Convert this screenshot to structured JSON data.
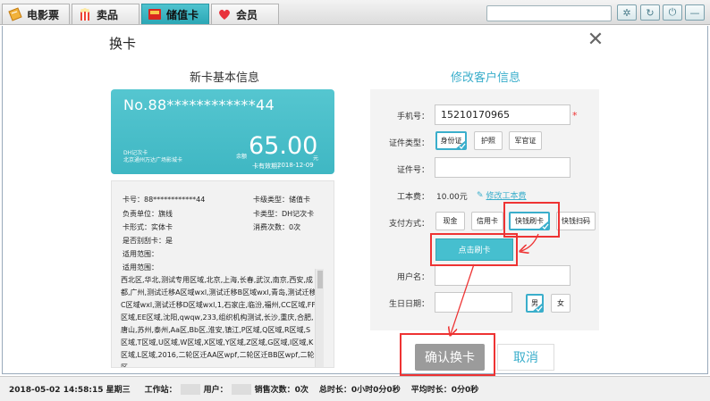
{
  "tabs": [
    {
      "label": "电影票",
      "icon": "ticket-icon",
      "active": false
    },
    {
      "label": "卖品",
      "icon": "popcorn-icon",
      "active": false
    },
    {
      "label": "储值卡",
      "icon": "card-icon",
      "active": true
    },
    {
      "label": "会员",
      "icon": "heart-icon",
      "active": false
    }
  ],
  "toolbar": {
    "icons": [
      "settings-icon",
      "refresh-icon",
      "power-icon",
      "minimize-icon"
    ]
  },
  "dialog": {
    "title": "换卡"
  },
  "left": {
    "section_title": "新卡基本信息",
    "card": {
      "number": "No.88************44",
      "type_line1": "DH记次卡",
      "type_line2": "北京通州万达广场影城卡",
      "balance_label": "余额",
      "balance": "65.00",
      "unit": "元",
      "expiry_label": "卡有效期：",
      "expiry": "2018-12-09"
    },
    "info": {
      "card_no": "卡号：88************44",
      "card_level": "卡级类型：储值卡",
      "unit": "负责单位：旗线",
      "card_type": "卡类型：DH记次卡",
      "card_form": "卡形式：实体卡",
      "consume_count": "消费次数：0次",
      "reissue": "是否别刮卡：是",
      "scope1": "适用范围：",
      "scope2": "适用范围：",
      "areas": "西北区,华北,测试专用区域,北京,上海,长春,武汉,南京,西安,成都,广州,测试迁移A区域wxl,测试迁移B区域wxl,青岛,测试迁移C区域wxl,测试迁移D区域wxl,1,石家庄,临汾,福州,CC区域,FF区域,EE区域,沈阳,qwqw,233,组织机构测试,长沙,重庆,合肥,唐山,苏州,泰州,Aa区,Bb区,淮安,镇江,P区域,Q区域,R区域,S区域,T区域,U区域,W区域,X区域,Y区域,Z区域,G区域,I区域,K区域,L区域,2016,二轮区迁AA区wpf,二轮区迁BB区wpf,二轮区"
    }
  },
  "right": {
    "section_title": "修改客户信息",
    "phone_label": "手机号：",
    "phone_value": "15210170965",
    "required_mark": "*",
    "id_type_label": "证件类型：",
    "id_types": [
      "身份证",
      "护照",
      "军官证"
    ],
    "id_no_label": "证件号：",
    "fee_label": "工本费：",
    "fee_value": "10.00元",
    "fee_link": "修改工本费",
    "pay_label": "支付方式：",
    "pay_options": [
      "现金",
      "信用卡",
      "快钱刷卡",
      "快钱扫码"
    ],
    "swipe_button": "点击刷卡",
    "username_label": "用户名：",
    "birthday_label": "生日日期：",
    "gender_options": [
      "男",
      "女"
    ]
  },
  "buttons": {
    "confirm": "确认换卡",
    "cancel": "取消"
  },
  "status": {
    "datetime": "2018-05-02 14:58:15 星期三",
    "workstation_label": "工作站：",
    "user_label": "用户：",
    "sales_count": "销售次数：0次",
    "total_time": "总时长：0小时0分0秒",
    "avg_time": "平均时长：0分0秒"
  },
  "colors": {
    "accent": "#3aaecb",
    "card": "#4bbec9",
    "highlight": "#ee3333"
  }
}
